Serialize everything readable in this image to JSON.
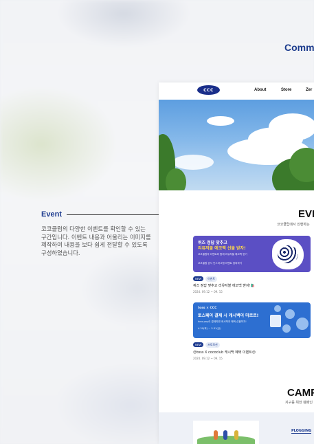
{
  "header": {
    "partial_heading": "Comm"
  },
  "annotation": {
    "label": "Event",
    "description": "코코클럽의 다양한 이벤트를 확인할 수 있는 구간입니다. 이벤트 내용과 어울리는 이미지를 제작하여 내용을 보다 쉽게 전달할 수 있도록 구성하였습니다."
  },
  "site": {
    "logo": "CCC",
    "nav": [
      "About",
      "Store",
      "Zer"
    ],
    "event_section": {
      "title": "EVE",
      "subtitle": "코코클럽에서 진행하는"
    },
    "events": [
      {
        "banner_title_1": "퀴즈 정답 맞추고",
        "banner_title_2": "리유저블 에코백 선물 받자!",
        "banner_line_1": "코코클럽의 이벤트와 함께 리유저블 에코백 받기",
        "banner_line_2": "코코클럽 공식 인스타그램 이벤트 참여하기",
        "tag_new": "NEW",
        "tag_cat": "이벤트",
        "title": "퀴즈 정답 맞추고 리유저블 에코백 받자!🛍️",
        "date": "2024. 09.12 ~ 09. 15"
      },
      {
        "brand_line": "toss × CCC",
        "banner_title_1": "토스페이 결제 시 캐시백이 마르르!",
        "banner_line_1": "toss pay로 결제하면 캐시백과 혜택 선물까지!",
        "banner_date": "4.30(목) ~ 5.31(금)",
        "tag_new": "NEW",
        "tag_cat": "프로모션",
        "title": "😊toss X cococlub 캐시백 혜택 이벤트😊",
        "date": "2024. 09.12 ~ 09. 15"
      }
    ],
    "camp_section": {
      "title": "CAMP",
      "subtitle": "지구를 위한 캠페인"
    },
    "plogging_link": "PLOGGING"
  }
}
